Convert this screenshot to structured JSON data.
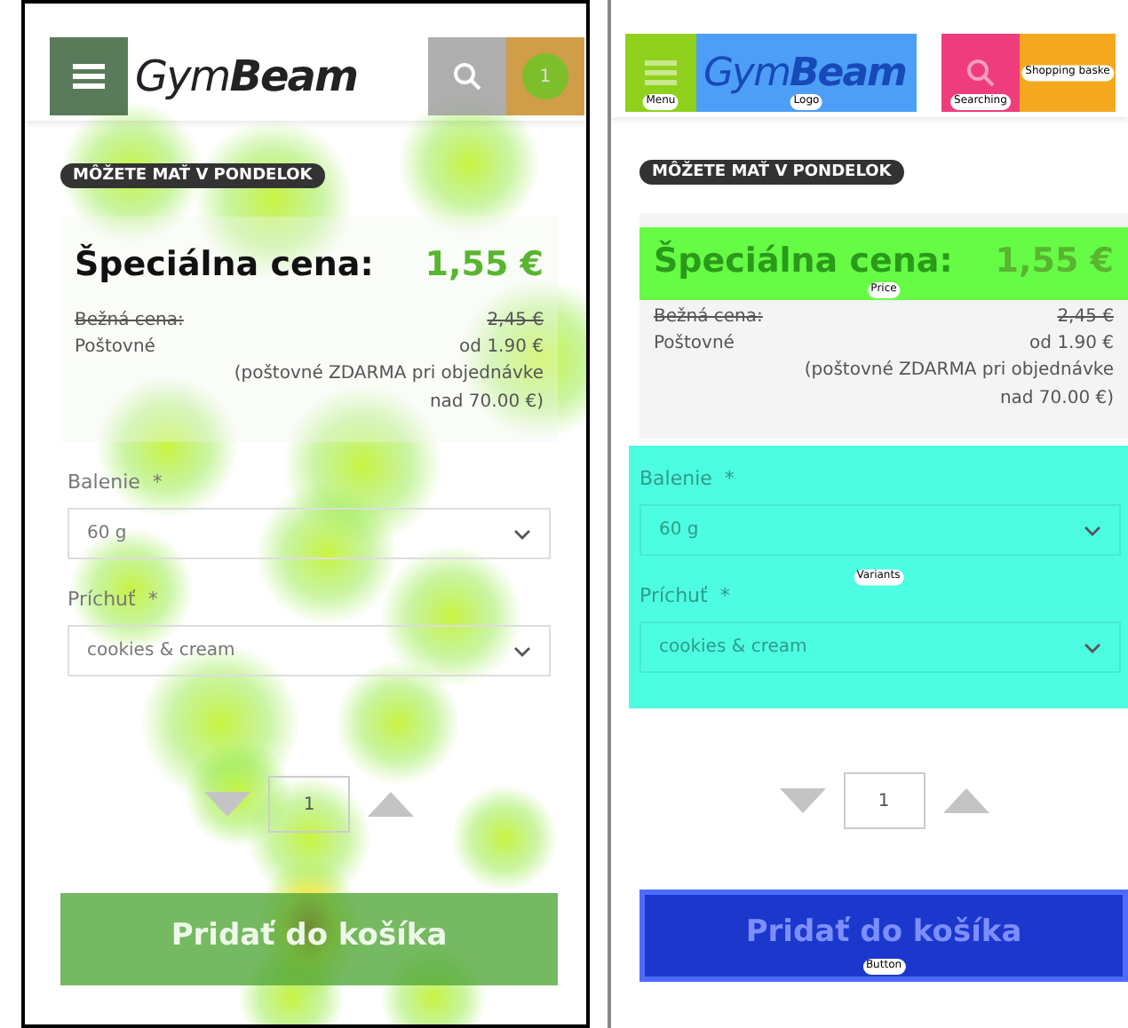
{
  "panels": [
    {
      "kind": "heatmap",
      "logo": {
        "light": "Gym",
        "bold": "Beam"
      },
      "cart_count": "1",
      "badge": "MÔŽETE MAŤ V PONDELOK",
      "special_label": "Špeciálna cena:",
      "special_price": "1,55 €",
      "regular_label": "Bežná cena:",
      "regular_price": "2,45 €",
      "shipping_label": "Poštovné",
      "shipping_price": "od 1.90 €",
      "shipping_note": "(poštovné ZDARMA pri objednávke nad 70.00 €)",
      "fields": [
        {
          "label": "Balenie",
          "required": "*",
          "value": "60 g"
        },
        {
          "label": "Príchuť",
          "required": "*",
          "value": "cookies & cream"
        }
      ],
      "quantity": "1",
      "add_button": "Pridať do košíka"
    },
    {
      "kind": "aoi",
      "logo": {
        "light": "Gym",
        "bold": "Beam"
      },
      "badge": "MÔŽETE MAŤ V PONDELOK",
      "special_label": "Špeciálna cena:",
      "special_price": "1,55 €",
      "regular_label": "Bežná cena:",
      "regular_price": "2,45 €",
      "shipping_label": "Poštovné",
      "shipping_price": "od 1.90 €",
      "shipping_note": "(poštovné ZDARMA pri objednávke nad 70.00 €)",
      "fields": [
        {
          "label": "Balenie",
          "required": "*",
          "value": "60 g"
        },
        {
          "label": "Príchuť",
          "required": "*",
          "value": "cookies & cream"
        }
      ],
      "quantity": "1",
      "add_button": "Pridať do košíka",
      "aoi_menu": {
        "label": "Menu",
        "color": "#8fd11c"
      },
      "aoi_logo": {
        "label": "Logo",
        "color": "#4d9ef7"
      },
      "aoi_search": {
        "label": "Searching",
        "color": "#ee3c7c"
      },
      "aoi_cart": {
        "label": "Shopping baske",
        "color": "#f4a81e"
      },
      "aoi_price": {
        "label": "Price",
        "color": "#66fc46"
      },
      "aoi_variants": {
        "label": "Variants",
        "color": "#4dfde2"
      },
      "aoi_button": {
        "label": "Button",
        "color": "#1c38cc"
      }
    }
  ]
}
